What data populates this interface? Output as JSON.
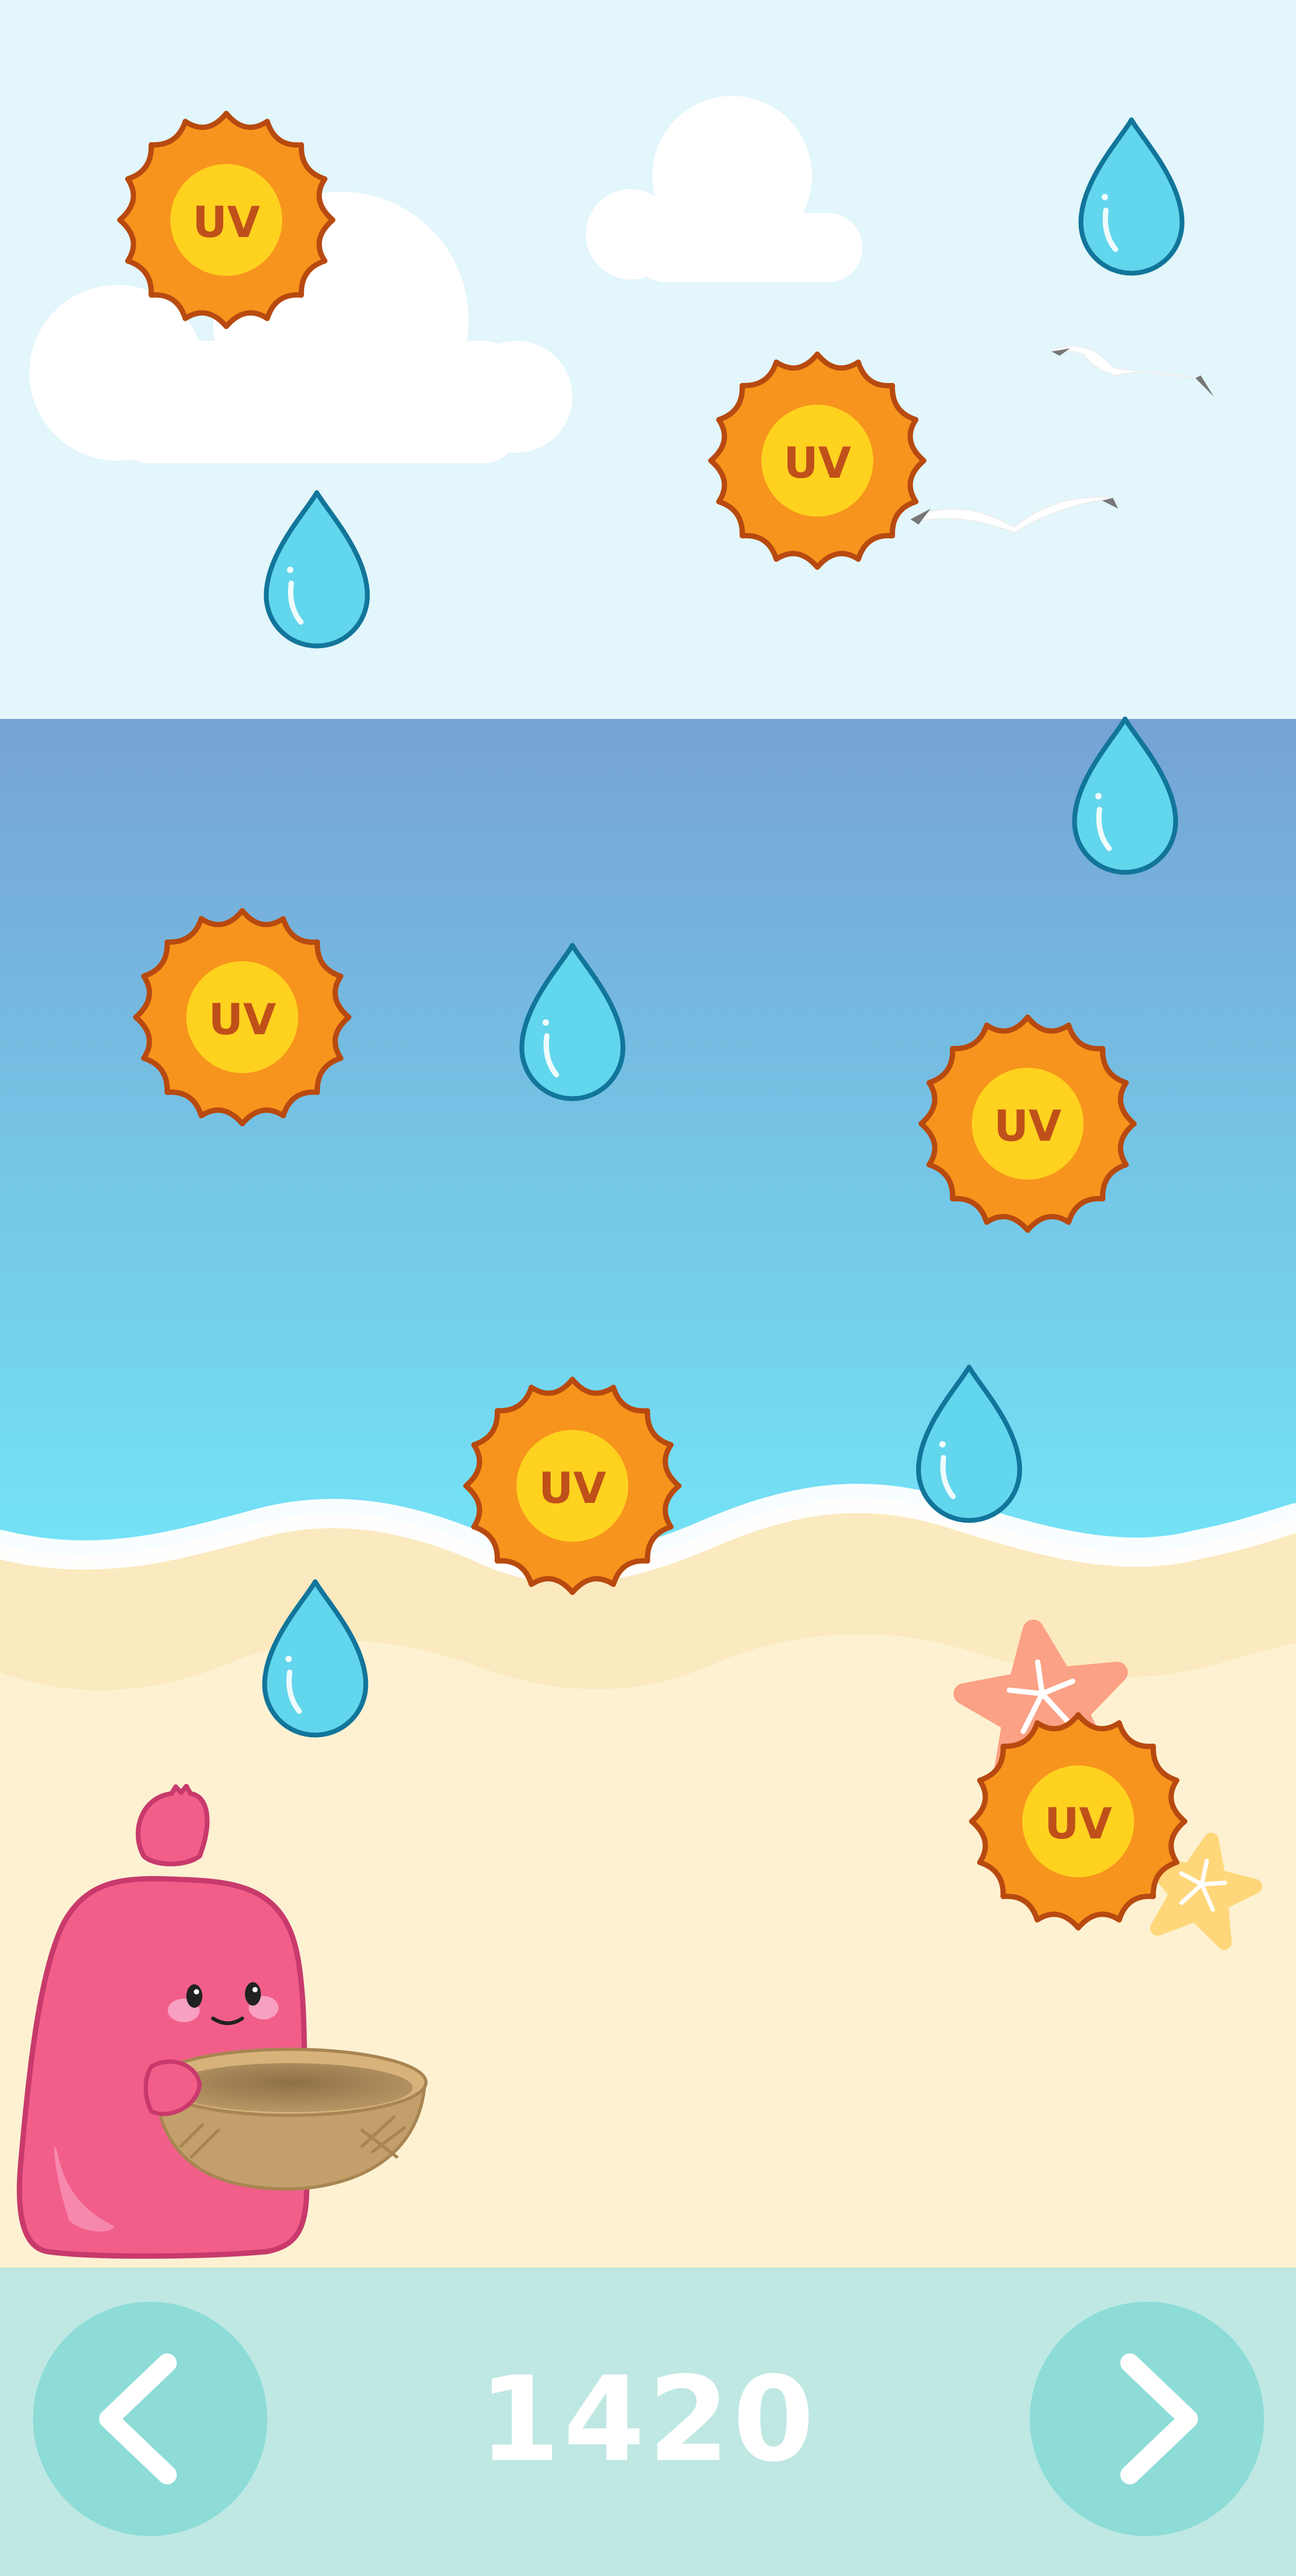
{
  "game": {
    "uv_label": "UV",
    "falling_items": [
      {
        "type": "uv-sun",
        "label": "UV"
      },
      {
        "type": "water-drop"
      },
      {
        "type": "uv-sun",
        "label": "UV"
      },
      {
        "type": "water-drop"
      },
      {
        "type": "water-drop"
      },
      {
        "type": "uv-sun",
        "label": "UV"
      },
      {
        "type": "water-drop"
      },
      {
        "type": "uv-sun",
        "label": "UV"
      },
      {
        "type": "uv-sun",
        "label": "UV"
      },
      {
        "type": "water-drop"
      },
      {
        "type": "water-drop"
      },
      {
        "type": "uv-sun",
        "label": "UV"
      }
    ]
  },
  "bottom_bar": {
    "score": "1420",
    "prev_icon": "chevron-left-icon",
    "next_icon": "chevron-right-icon"
  },
  "colors": {
    "sky": "#e2f6fb",
    "sea_top": "#76a3d4",
    "sea_bottom": "#74e6f8",
    "sand": "#fdf1d2",
    "bar": "#bfe8e3",
    "button": "#8ddcd8",
    "sun_outer": "#f7941d",
    "sun_inner": "#ffd21f",
    "sun_stroke": "#b84a10",
    "uv_text": "#c0501a",
    "drop": "#62d6ec",
    "drop_stroke": "#12759a",
    "character": "#f25e8a"
  }
}
